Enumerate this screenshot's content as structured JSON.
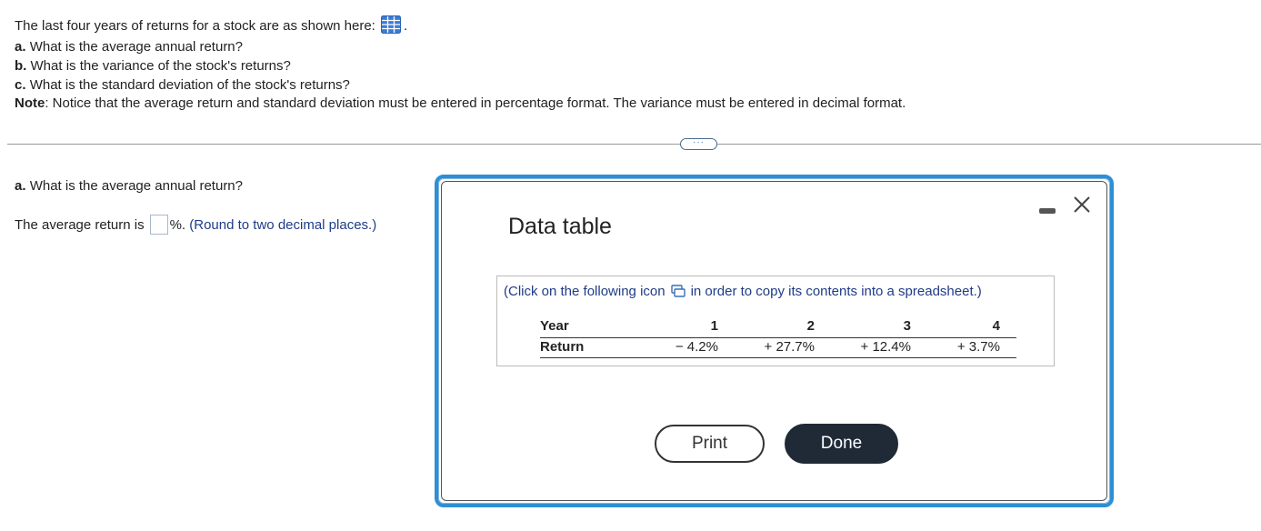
{
  "question": {
    "intro": "The last four years of returns for a stock are as shown here:",
    "intro_suffix": ".",
    "parts": [
      {
        "letter": "a.",
        "text": "What is the average annual return?"
      },
      {
        "letter": "b.",
        "text": "What is the variance of the stock's returns?"
      },
      {
        "letter": "c.",
        "text": "What is the standard deviation of the stock's returns?"
      }
    ],
    "note_label": "Note",
    "note_text": ": Notice that the average return and standard deviation must be entered in percentage format. The variance must be entered in decimal format."
  },
  "more_button": "···",
  "answer": {
    "part_letter": "a.",
    "part_text": "What is the average annual return?",
    "prompt": "The average return is",
    "unit": "%.",
    "hint": "(Round to two decimal places.)",
    "value": ""
  },
  "modal": {
    "title": "Data table",
    "copy_note_before": "(Click on the following icon",
    "copy_note_after": "in order to copy its contents into a spreadsheet.)",
    "table": {
      "header_label": "Year",
      "years": [
        "1",
        "2",
        "3",
        "4"
      ],
      "row_label": "Return",
      "returns": [
        "− 4.2%",
        "+ 27.7%",
        "+ 12.4%",
        "+ 3.7%"
      ]
    },
    "print_label": "Print",
    "done_label": "Done"
  },
  "colors": {
    "modal_border": "#2d8fd5",
    "hint_text": "#1f3c88",
    "done_button": "#1f2a36"
  }
}
